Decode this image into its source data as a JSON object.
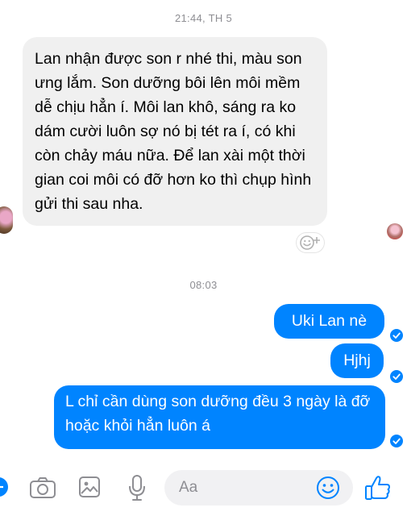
{
  "thread": {
    "timestamp_1": "21:44, TH 5",
    "timestamp_2": "08:03"
  },
  "messages": [
    {
      "sender": "other",
      "text": "Lan nhận được son r nhé thi, màu son ưng lắm. Son dưỡng bôi lên môi mềm dễ chịu hẳn í. Môi lan khô, sáng ra ko dám cười luôn sợ nó bị tét ra í, có khi còn chảy máu nữa. Để lan xài một thời gian coi môi có đỡ hơn ko thì chụp hình gửi thi sau nha."
    },
    {
      "sender": "me",
      "text": "Uki Lan nè"
    },
    {
      "sender": "me",
      "text": "Hjhj"
    },
    {
      "sender": "me",
      "text": "L chỉ cần dùng son dưỡng đều 3 ngày là đỡ hoặc khỏi hẳn luôn á"
    }
  ],
  "composer": {
    "placeholder": "Aa",
    "icons": [
      "camera-icon",
      "image-icon",
      "microphone-icon",
      "emoji-icon",
      "thumbs-up-icon"
    ]
  },
  "colors": {
    "accent": "#0084ff",
    "incoming_bubble": "#f0f0f0",
    "timestamp": "#8e8e93"
  }
}
